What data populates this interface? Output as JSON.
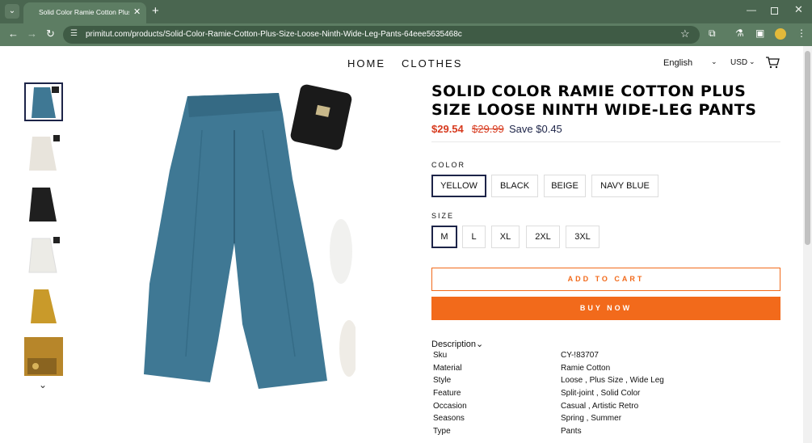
{
  "browser": {
    "tab_title": "Solid Color Ramie Cotton Plus Size Loose Ninth Wide-Leg Pants",
    "url": "primitut.com/products/Solid-Color-Ramie-Cotton-Plus-Size-Loose-Ninth-Wide-Leg-Pants-64eee5635468c"
  },
  "header": {
    "nav": [
      "HOME",
      "CLOTHES"
    ],
    "language": "English",
    "currency": "USD"
  },
  "gallery": {
    "thumbnail_colors": [
      "#3f7894",
      "#e8e4dc",
      "#1f1f1f",
      "#ecebe6",
      "#c99a2a",
      "#b7862a"
    ]
  },
  "product": {
    "title": "SOLID COLOR RAMIE COTTON PLUS SIZE LOOSE NINTH WIDE-LEG PANTS",
    "price": "$29.54",
    "compare_price": "$29.99",
    "save_text": "Save $0.45",
    "color_label": "COLOR",
    "colors": [
      "YELLOW",
      "BLACK",
      "BEIGE",
      "NAVY BLUE"
    ],
    "selected_color": "YELLOW",
    "size_label": "SIZE",
    "sizes": [
      "M",
      "L",
      "XL",
      "2XL",
      "3XL"
    ],
    "selected_size": "M",
    "add_to_cart": "ADD TO CART",
    "buy_now": "BUY NOW",
    "description_label": "Description",
    "specs": [
      {
        "key": "Sku",
        "value": "CY-!83707"
      },
      {
        "key": "Material",
        "value": "Ramie Cotton"
      },
      {
        "key": "Style",
        "value": "Loose , Plus Size , Wide Leg"
      },
      {
        "key": "Feature",
        "value": "Split-joint , Solid Color"
      },
      {
        "key": "Occasion",
        "value": "Casual , Artistic Retro"
      },
      {
        "key": "Seasons",
        "value": "Spring , Summer"
      },
      {
        "key": "Type",
        "value": "Pants"
      }
    ]
  },
  "colors": {
    "accent_orange": "#f26a1b",
    "price_red": "#d73a1e",
    "navy": "#1d2448",
    "pants_blue": "#3f7894"
  }
}
